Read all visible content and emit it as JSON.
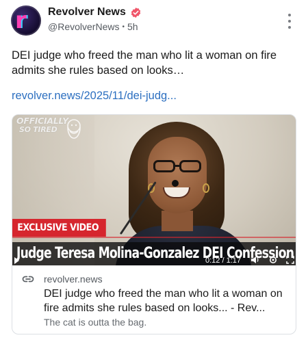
{
  "post": {
    "author_name": "Revolver News",
    "handle": "@RevolverNews",
    "separator": "•",
    "time_ago": "5h",
    "text": "DEI judge who freed the man who lit a woman on fire admits she rules based on looks…",
    "link_text": "revolver.news/2025/11/dei-judg...",
    "verified_color": "#f0566a",
    "link_color": "#2c6fc0"
  },
  "card": {
    "thumbnail": {
      "watermark_line1": "OFFICIALLY",
      "watermark_line2": "SO TIRED",
      "badge_label": "EXCLUSIVE VIDEO",
      "caption": "Judge Teresa Molina-Gonzalez DEI Confession",
      "timecode": "0:12 / 1:17",
      "badge_color": "#d6262e"
    },
    "domain": "revolver.news",
    "title": "DEI judge who freed the man who lit a woman on fire admits she rules based on looks... - Rev...",
    "description": "The cat is outta the bag."
  },
  "icons": {
    "verified": "verified-badge-icon",
    "more": "more-vertical-icon",
    "link": "link-chain-icon",
    "play": "play-icon",
    "volume": "volume-icon",
    "settings": "gear-icon",
    "fullscreen": "fullscreen-icon"
  }
}
